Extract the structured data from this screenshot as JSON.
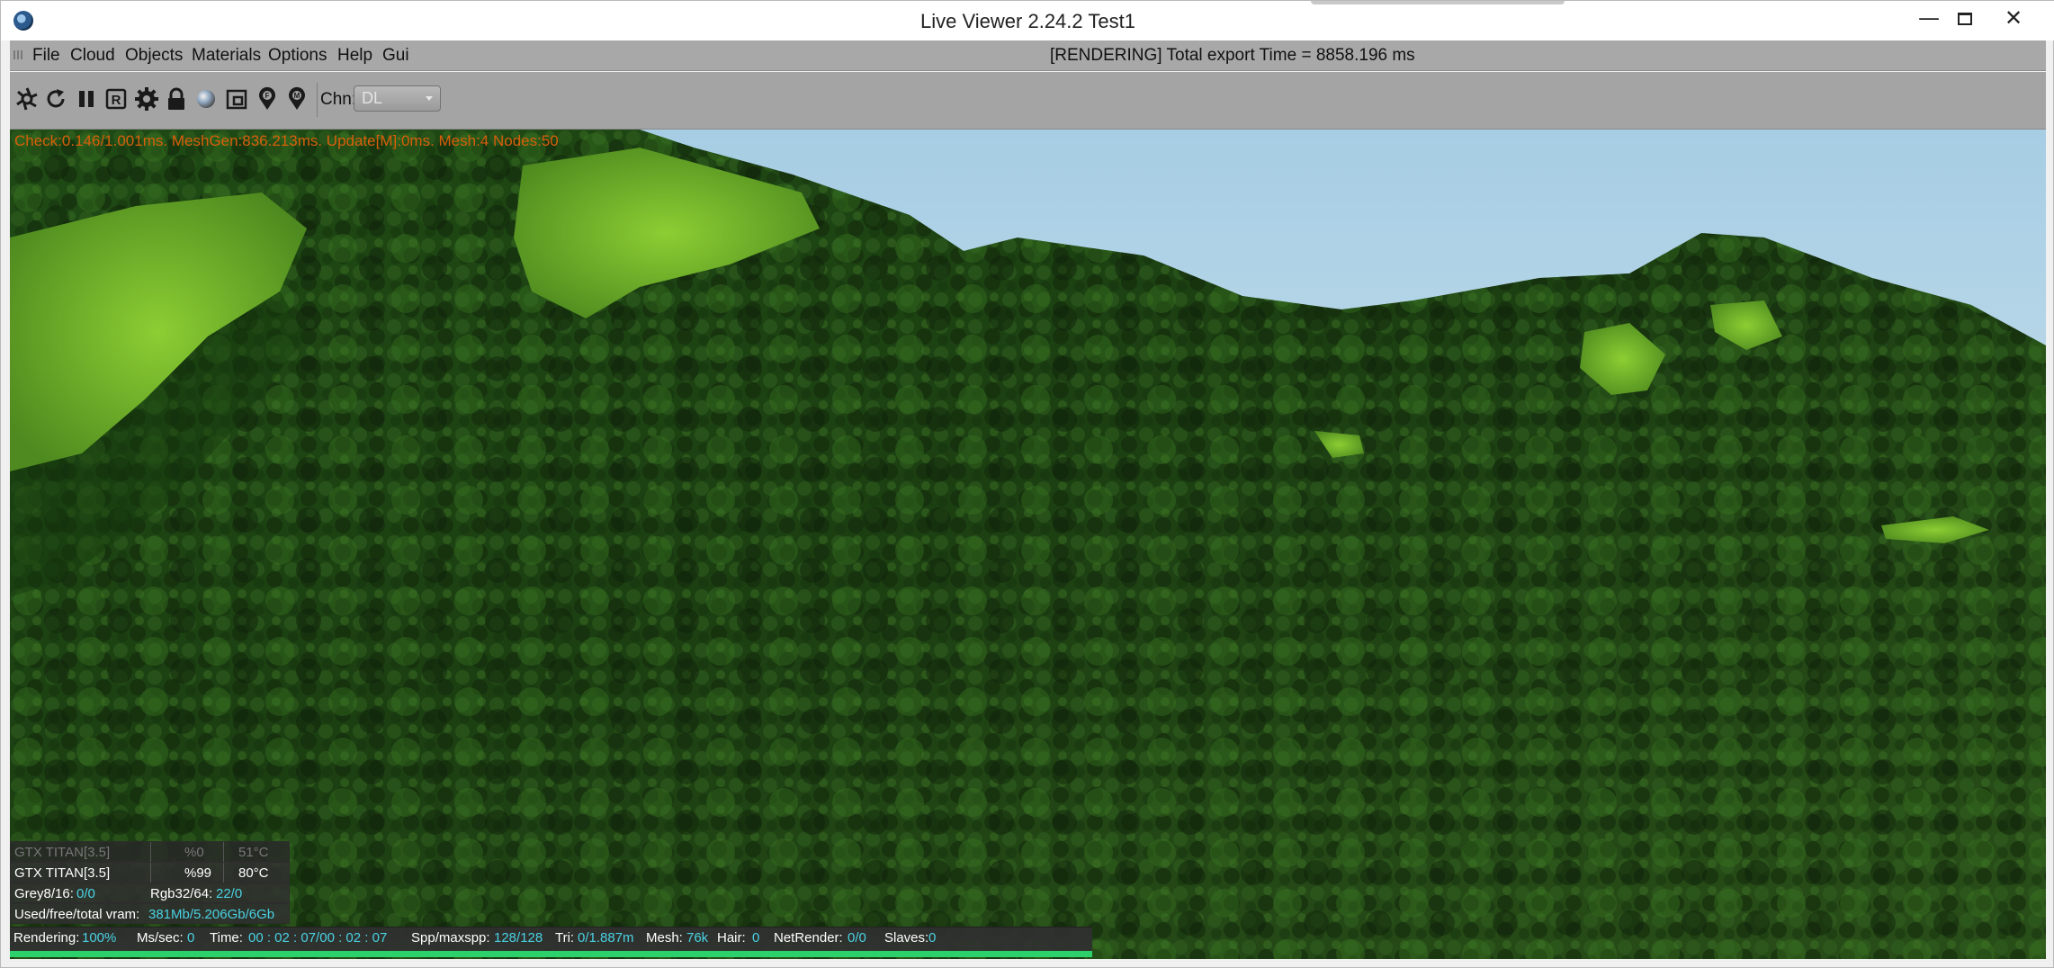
{
  "window": {
    "title": "Live Viewer 2.24.2 Test1"
  },
  "menu": {
    "items": [
      "File",
      "Cloud",
      "Objects",
      "Materials",
      "Options",
      "Help",
      "Gui"
    ],
    "status": "[RENDERING] Total export Time = 8858.196 ms"
  },
  "toolbar": {
    "icons": [
      "aperture-icon",
      "refresh-icon",
      "pause-icon",
      "render-region-icon",
      "settings-icon",
      "lock-icon",
      "material-sphere-icon",
      "region-box-icon",
      "pin-f-icon",
      "pin-m-icon"
    ],
    "channel_label": "Chn:",
    "channel_value": "DL"
  },
  "viewport": {
    "info_line": "Check:0.146/1.001ms. MeshGen:836.213ms. Update[M]:0ms. Mesh:4 Nodes:50"
  },
  "gpus": [
    {
      "name": "GTX TITAN[3.5]",
      "usage": "%0",
      "temp": "51°C",
      "active": false
    },
    {
      "name": "GTX TITAN[3.5]",
      "usage": "%99",
      "temp": "80°C",
      "active": true
    }
  ],
  "memory": {
    "grey_label": "Grey8/16:",
    "grey_value": "0/0",
    "rgb_label": "Rgb32/64:",
    "rgb_value": "22/0",
    "vram_label": "Used/free/total vram:",
    "vram_value": "381Mb/5.206Gb/6Gb"
  },
  "status": {
    "rendering_label": "Rendering:",
    "rendering_value": "100%",
    "mssec_label": "Ms/sec:",
    "mssec_value": "0",
    "time_label": "Time:",
    "time_value": "00 : 02 : 07/00 : 02 : 07",
    "spp_label": "Spp/maxspp:",
    "spp_value": "128/128",
    "tri_label": "Tri:",
    "tri_value": "0/1.887m",
    "mesh_label": "Mesh:",
    "mesh_value": "76k",
    "hair_label": "Hair:",
    "hair_value": "0",
    "netrender_label": "NetRender:",
    "netrender_value": "0/0",
    "slaves_label": "Slaves:",
    "slaves_value": "0"
  },
  "progress": 1.0,
  "colors": {
    "menu_bg": "#a8a8a8",
    "toolbar_bg": "#a4a4a4",
    "overlay_text": "#d85f0b",
    "cyan": "#4ad2e4",
    "progress": "#2dd16b"
  }
}
